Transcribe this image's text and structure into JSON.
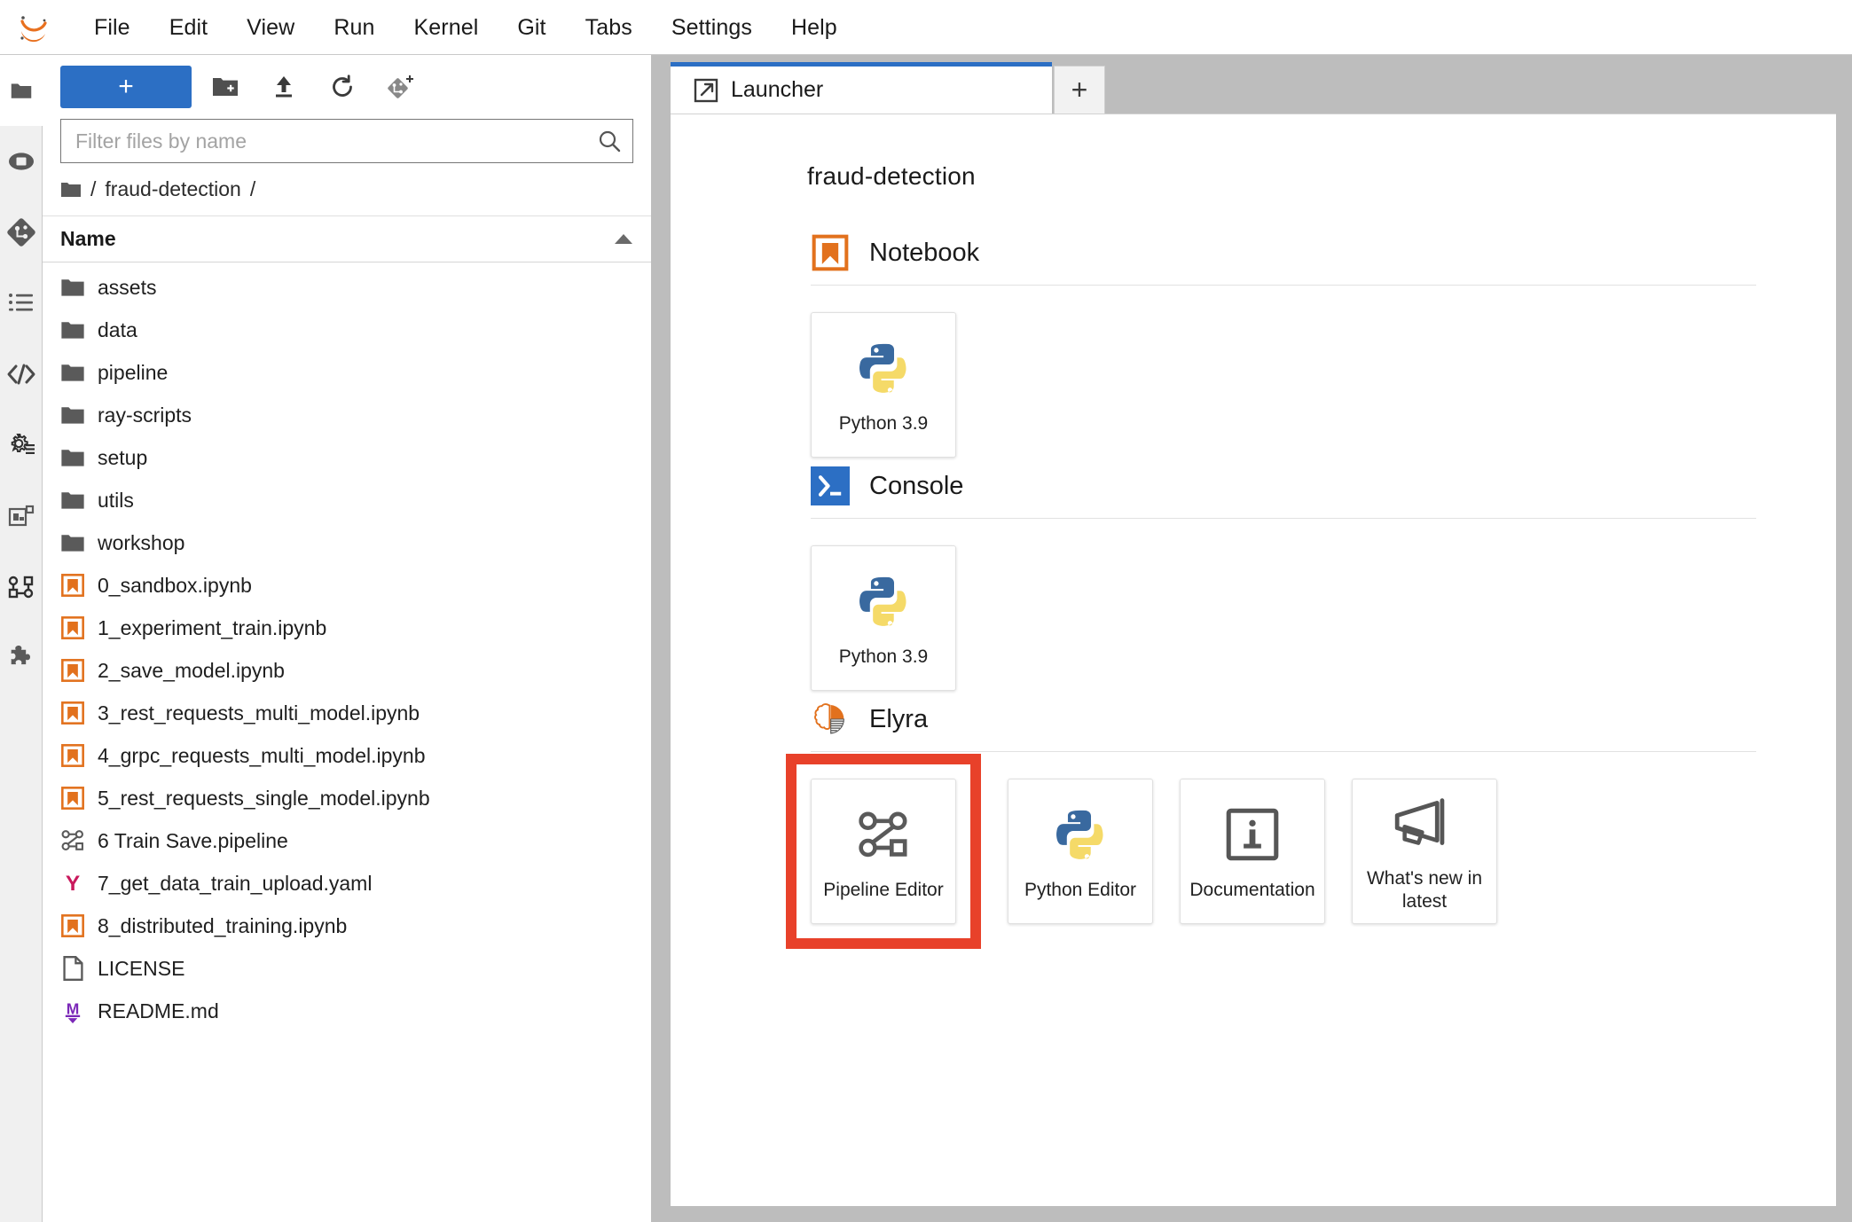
{
  "app": {
    "logo_icon": "jupyter-logo"
  },
  "menubar": {
    "items": [
      {
        "label": "File"
      },
      {
        "label": "Edit"
      },
      {
        "label": "View"
      },
      {
        "label": "Run"
      },
      {
        "label": "Kernel"
      },
      {
        "label": "Git"
      },
      {
        "label": "Tabs"
      },
      {
        "label": "Settings"
      },
      {
        "label": "Help"
      }
    ]
  },
  "rail": {
    "items": [
      {
        "icon": "folder-icon",
        "name": "file-browser"
      },
      {
        "icon": "running-terminals-icon",
        "name": "running-sessions"
      },
      {
        "icon": "git-icon",
        "name": "git"
      },
      {
        "icon": "table-of-contents-icon",
        "name": "table-of-contents"
      },
      {
        "icon": "code-icon",
        "name": "code-snippets"
      },
      {
        "icon": "gear-settings-icon",
        "name": "settings-editor"
      },
      {
        "icon": "extension-manager-icon",
        "name": "extension-manager"
      },
      {
        "icon": "pipeline-graph-icon",
        "name": "runtimes"
      },
      {
        "icon": "puzzle-icon",
        "name": "extensions"
      }
    ]
  },
  "filebrowser": {
    "toolbar": {
      "new_label": "+",
      "new_folder_icon": "new-folder-icon",
      "upload_icon": "upload-icon",
      "refresh_icon": "refresh-icon",
      "new_git_icon": "new-git-branch-icon"
    },
    "filter": {
      "placeholder": "Filter files by name",
      "value": "",
      "icon": "search-icon"
    },
    "breadcrumb": {
      "root_icon": "folder-icon",
      "leading_separator": "/",
      "path": "fraud-detection",
      "trailing_separator": "/"
    },
    "column_header": {
      "name": "Name",
      "sort_icon": "sort-ascending-icon"
    },
    "items": [
      {
        "name": "assets",
        "icon": "folder-icon"
      },
      {
        "name": "data",
        "icon": "folder-icon"
      },
      {
        "name": "pipeline",
        "icon": "folder-icon"
      },
      {
        "name": "ray-scripts",
        "icon": "folder-icon"
      },
      {
        "name": "setup",
        "icon": "folder-icon"
      },
      {
        "name": "utils",
        "icon": "folder-icon"
      },
      {
        "name": "workshop",
        "icon": "folder-icon"
      },
      {
        "name": "0_sandbox.ipynb",
        "icon": "notebook-icon"
      },
      {
        "name": "1_experiment_train.ipynb",
        "icon": "notebook-icon"
      },
      {
        "name": "2_save_model.ipynb",
        "icon": "notebook-icon"
      },
      {
        "name": "3_rest_requests_multi_model.ipynb",
        "icon": "notebook-icon"
      },
      {
        "name": "4_grpc_requests_multi_model.ipynb",
        "icon": "notebook-icon"
      },
      {
        "name": "5_rest_requests_single_model.ipynb",
        "icon": "notebook-icon"
      },
      {
        "name": "6 Train Save.pipeline",
        "icon": "pipeline-icon"
      },
      {
        "name": "7_get_data_train_upload.yaml",
        "icon": "yaml-icon"
      },
      {
        "name": "8_distributed_training.ipynb",
        "icon": "notebook-icon"
      },
      {
        "name": "LICENSE",
        "icon": "file-icon"
      },
      {
        "name": "README.md",
        "icon": "markdown-icon"
      }
    ]
  },
  "tabbar": {
    "tabs": [
      {
        "label": "Launcher",
        "icon": "launcher-icon",
        "active": true
      }
    ],
    "add_label": "+"
  },
  "launcher": {
    "cwd": "fraud-detection",
    "sections": [
      {
        "title": "Notebook",
        "icon": "notebook-icon",
        "cards": [
          {
            "label": "Python 3.9",
            "icon": "python-icon",
            "highlighted": false
          }
        ]
      },
      {
        "title": "Console",
        "icon": "console-icon",
        "cards": [
          {
            "label": "Python 3.9",
            "icon": "python-icon",
            "highlighted": false
          }
        ]
      },
      {
        "title": "Elyra",
        "icon": "elyra-icon",
        "cards": [
          {
            "label": "Pipeline Editor",
            "icon": "pipeline-icon",
            "highlighted": true
          },
          {
            "label": "Python Editor",
            "icon": "python-icon",
            "highlighted": false
          },
          {
            "label": "Documentation",
            "icon": "info-icon",
            "highlighted": false
          },
          {
            "label": "What's new in latest",
            "icon": "megaphone-icon",
            "highlighted": false
          }
        ]
      }
    ]
  },
  "colors": {
    "accent_blue": "#2c6fc4",
    "notebook_orange": "#e2711d",
    "highlight_red": "#e8412a",
    "yaml_pink": "#c9185c",
    "markdown_purple": "#7b28b8",
    "chrome_gray": "#bdbdbd"
  }
}
